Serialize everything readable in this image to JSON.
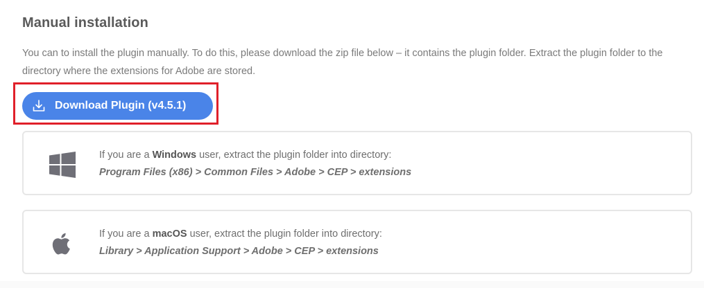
{
  "section": {
    "title": "Manual installation",
    "description": "You can to install the plugin manually. To do this, please download the zip file below – it contains the plugin folder. Extract the plugin folder to the directory where the extensions for Adobe are stored."
  },
  "download_button": {
    "label": "Download Plugin (v4.5.1)",
    "icon": "download-icon",
    "color": "#4a84e8"
  },
  "highlight_color": "#e0202a",
  "cards": {
    "windows": {
      "icon": "windows-icon",
      "prefix": "If you are a ",
      "os_name": "Windows",
      "suffix": " user, extract the plugin folder into directory:",
      "path": "Program Files (x86) > Common Files > Adobe > CEP > extensions"
    },
    "macos": {
      "icon": "apple-icon",
      "prefix": "If you are a ",
      "os_name": "macOS",
      "suffix": " user, extract the plugin folder into directory:",
      "path": "Library > Application Support > Adobe > CEP > extensions"
    }
  }
}
